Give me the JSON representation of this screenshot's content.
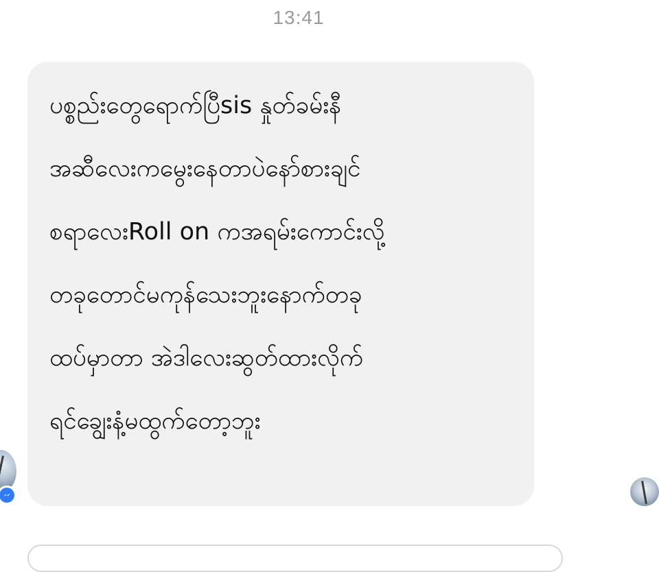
{
  "header": {
    "timestamp": "13:41"
  },
  "message": {
    "lines": [
      "ပစ္စည်းတွေရောက်ပြီsis နှုတ်ခမ်းနီ",
      "အဆီလေးကမွေးနေတာပဲနော်စားချင်",
      "စရာလေးRoll on ကအရမ်းကောင်းလို့",
      "တခုတောင်မကုန်သေးဘူးနောက်တခု",
      "ထပ်မှာတာ အဲဒါလေးဆွတ်ထားလိုက်",
      "ရင်ချွေးနံ့မထွက်တော့ဘူး"
    ]
  },
  "colors": {
    "bubble_background": "#f1f1f2",
    "timestamp_text": "#9b9b9b",
    "messenger_badge": "#2f7cf6"
  },
  "icons": {
    "sender_avatar": "sender-avatar",
    "messenger_badge": "messenger-icon",
    "read_receipt_avatar": "read-receipt-avatar"
  }
}
